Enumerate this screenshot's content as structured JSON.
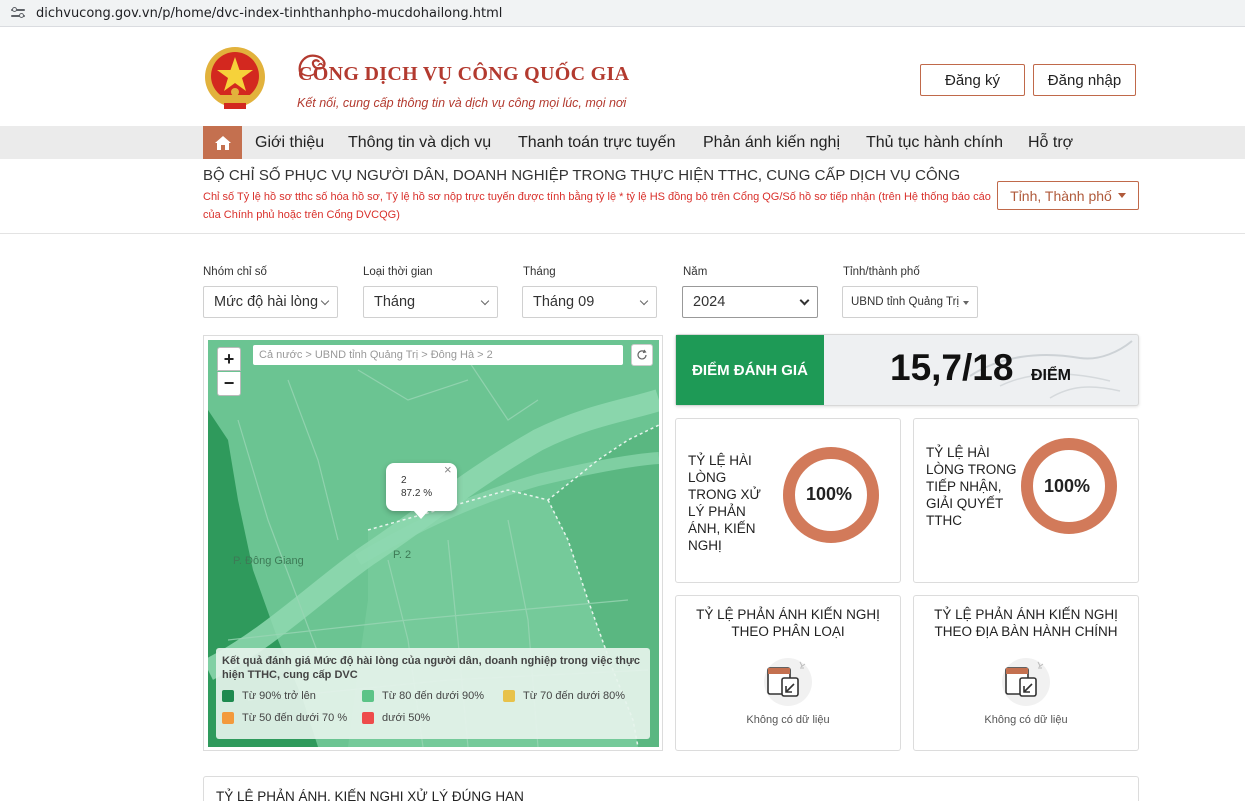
{
  "browser": {
    "url": "dichvucong.gov.vn/p/home/dvc-index-tinhthanhpho-mucdohailong.html"
  },
  "header": {
    "title": "CỔNG DỊCH VỤ CÔNG QUỐC GIA",
    "subtitle": "Kết nối, cung cấp thông tin và dịch vụ công mọi lúc, mọi nơi",
    "register_label": "Đăng ký",
    "login_label": "Đăng nhập"
  },
  "nav": {
    "items": [
      "Giới thiệu",
      "Thông tin và dịch vụ",
      "Thanh toán trực tuyến",
      "Phản ánh kiến nghị",
      "Thủ tục hành chính",
      "Hỗ trợ"
    ]
  },
  "section": {
    "title": "BỘ CHỈ SỐ PHỤC VỤ NGƯỜI DÂN, DOANH NGHIỆP TRONG THỰC HIỆN TTHC, CUNG CẤP DỊCH VỤ CÔNG",
    "note": "Chỉ số Tỷ lệ hồ sơ tthc số hóa hồ sơ, Tỷ lệ hồ sơ nộp trực tuyến được tính bằng tỷ lệ * tỷ lệ HS đồng bộ trên Cổng QG/Số hồ sơ tiếp nhận (trên Hệ thống báo cáo của Chính phủ hoặc trên Cổng DVCQG)",
    "province_button": "Tỉnh, Thành phố"
  },
  "filters": {
    "group": {
      "label": "Nhóm chỉ số",
      "value": "Mức độ hài lòng"
    },
    "time_type": {
      "label": "Loại thời gian",
      "value": "Tháng"
    },
    "month": {
      "label": "Tháng",
      "value": "Tháng 09"
    },
    "year": {
      "label": "Năm",
      "value": "2024"
    },
    "province": {
      "label": "Tỉnh/thành phố",
      "value": "UBND tỉnh Quảng Trị"
    }
  },
  "map": {
    "breadcrumb": "Cả nước > UBND tỉnh Quảng Trị > Đông Hà > 2",
    "zoom_in": "+",
    "zoom_out": "−",
    "popup": {
      "name": "2",
      "value": "87.2 %",
      "close": "×"
    },
    "place_labels": {
      "dong_giang": "P. Đông Giang",
      "p2": "P. 2"
    },
    "legend": {
      "title": "Kết quả đánh giá Mức độ hài lòng của người dân, doanh nghiệp trong việc thực hiện TTHC, cung cấp DVC",
      "items": [
        {
          "label": "Từ 90% trở lên",
          "color": "#1e8a4f"
        },
        {
          "label": "Từ 80 đến dưới 90%",
          "color": "#5cc487"
        },
        {
          "label": "Từ 70 đến dưới 80%",
          "color": "#e8c24a"
        },
        {
          "label": "Từ 50 đến dưới 70 %",
          "color": "#f39a3c"
        },
        {
          "label": "dưới 50%",
          "color": "#ee4b4b"
        }
      ]
    }
  },
  "score": {
    "label": "ĐIỂM ĐÁNH GIÁ",
    "value": "15,7/18",
    "unit": "ĐIỂM",
    "accent": "#1e9a56"
  },
  "stats": {
    "handling": {
      "label": "TỶ LỆ HÀI LÒNG TRONG XỬ LÝ PHẢN ÁNH, KIẾN NGHỊ",
      "value": "100%",
      "fraction": 1.0
    },
    "receiving": {
      "label": "TỶ LỆ HÀI LÒNG TRONG TIẾP NHẬN, GIẢI QUYẾT TTHC",
      "value": "100%",
      "fraction": 1.0
    },
    "donut_color": "#d27a5a"
  },
  "reports": {
    "by_type": {
      "title": "TỶ LỆ PHẢN ÁNH KIẾN NGHỊ THEO PHÂN LOẠI",
      "empty": "Không có dữ liệu"
    },
    "by_area": {
      "title": "TỶ LỆ PHẢN ÁNH KIẾN NGHỊ THEO ĐỊA BÀN HÀNH CHÍNH",
      "empty": "Không có dữ liệu"
    }
  },
  "bottom": {
    "title": "TỶ LỆ PHẢN ÁNH, KIẾN NGHỊ XỬ LÝ ĐÚNG HẠN"
  }
}
